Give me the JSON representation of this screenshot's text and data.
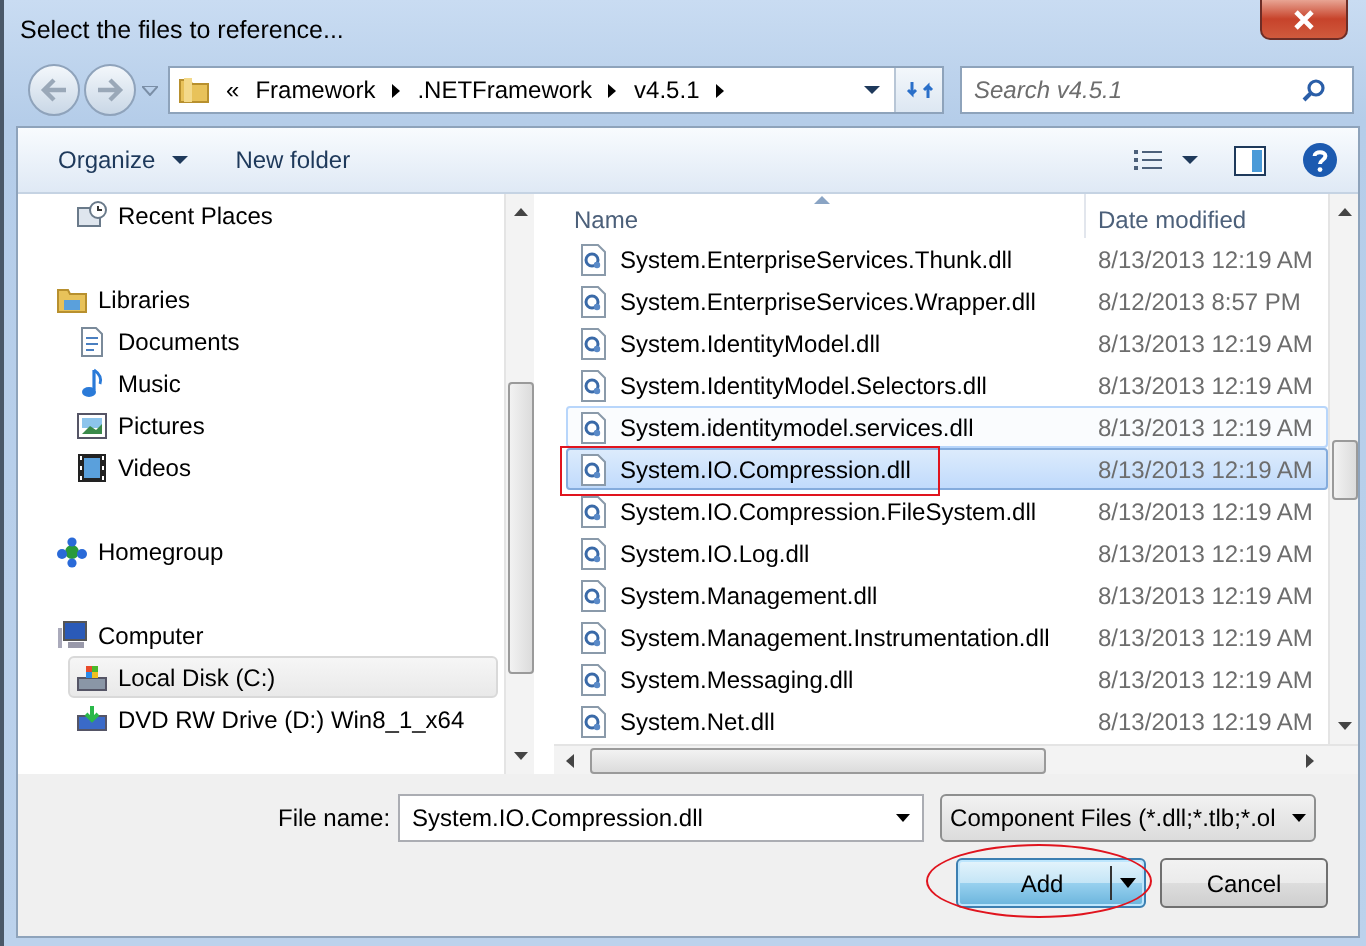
{
  "window": {
    "title": "Select the files to reference..."
  },
  "address": {
    "overflow": "«",
    "crumbs": [
      "Framework",
      ".NETFramework",
      "v4.5.1"
    ]
  },
  "search": {
    "placeholder": "Search v4.5.1"
  },
  "toolbar": {
    "organize": "Organize",
    "new_folder": "New folder"
  },
  "nav": [
    {
      "children": [
        {
          "label": "Recent Places",
          "kind": "recent",
          "selected": false
        }
      ]
    },
    {
      "label": "Libraries",
      "kind": "library",
      "selected": false,
      "children": [
        {
          "label": "Documents",
          "kind": "document",
          "selected": false
        },
        {
          "label": "Music",
          "kind": "music",
          "selected": false
        },
        {
          "label": "Pictures",
          "kind": "pictures",
          "selected": false
        },
        {
          "label": "Videos",
          "kind": "videos",
          "selected": false
        }
      ]
    },
    {
      "label": "Homegroup",
      "kind": "homegroup",
      "selected": false
    },
    {
      "label": "Computer",
      "kind": "computer",
      "selected": false,
      "children": [
        {
          "label": "Local Disk (C:)",
          "kind": "disk",
          "selected": true
        },
        {
          "label": "DVD RW Drive (D:) Win8_1_x64",
          "kind": "dvd",
          "selected": false
        }
      ]
    }
  ],
  "files": {
    "columns": [
      "Name",
      "Date modified"
    ],
    "rows": [
      {
        "name": "System.EnterpriseServices.Thunk.dll",
        "date": "8/13/2013 12:19 AM",
        "selected": false,
        "hovered": false,
        "marked": false
      },
      {
        "name": "System.EnterpriseServices.Wrapper.dll",
        "date": "8/12/2013 8:57 PM",
        "selected": false,
        "hovered": false,
        "marked": false
      },
      {
        "name": "System.IdentityModel.dll",
        "date": "8/13/2013 12:19 AM",
        "selected": false,
        "hovered": false,
        "marked": false
      },
      {
        "name": "System.IdentityModel.Selectors.dll",
        "date": "8/13/2013 12:19 AM",
        "selected": false,
        "hovered": false,
        "marked": false
      },
      {
        "name": "System.identitymodel.services.dll",
        "date": "8/13/2013 12:19 AM",
        "selected": false,
        "hovered": true,
        "marked": false
      },
      {
        "name": "System.IO.Compression.dll",
        "date": "8/13/2013 12:19 AM",
        "selected": true,
        "hovered": false,
        "marked": true
      },
      {
        "name": "System.IO.Compression.FileSystem.dll",
        "date": "8/13/2013 12:19 AM",
        "selected": false,
        "hovered": false,
        "marked": false
      },
      {
        "name": "System.IO.Log.dll",
        "date": "8/13/2013 12:19 AM",
        "selected": false,
        "hovered": false,
        "marked": false
      },
      {
        "name": "System.Management.dll",
        "date": "8/13/2013 12:19 AM",
        "selected": false,
        "hovered": false,
        "marked": false
      },
      {
        "name": "System.Management.Instrumentation.dll",
        "date": "8/13/2013 12:19 AM",
        "selected": false,
        "hovered": false,
        "marked": false
      },
      {
        "name": "System.Messaging.dll",
        "date": "8/13/2013 12:19 AM",
        "selected": false,
        "hovered": false,
        "marked": false
      },
      {
        "name": "System.Net.dll",
        "date": "8/13/2013 12:19 AM",
        "selected": false,
        "hovered": false,
        "marked": false
      }
    ]
  },
  "file_name": {
    "label": "File name:",
    "value": "System.IO.Compression.dll"
  },
  "filter": {
    "value": "Component Files (*.dll;*.tlb;*.ol"
  },
  "buttons": [
    {
      "label": "Add",
      "kind": "split",
      "marked": true
    },
    {
      "label": "Cancel",
      "kind": "plain",
      "marked": false
    }
  ]
}
